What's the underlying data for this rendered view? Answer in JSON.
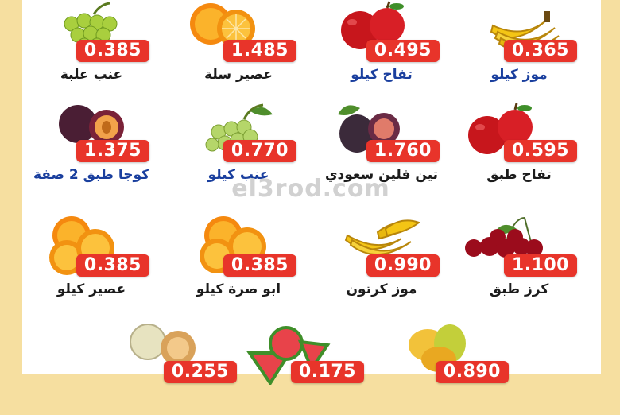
{
  "items": [
    {
      "id": "banana-kilo",
      "name": "موز كيلو",
      "price": "0.365",
      "fruit": "banana",
      "name_color": "blue"
    },
    {
      "id": "apple-kilo",
      "name": "تفاح كيلو",
      "price": "0.495",
      "fruit": "apple",
      "name_color": "blue"
    },
    {
      "id": "orange-juice-basket",
      "name": "عصير سلة",
      "price": "1.485",
      "fruit": "orange",
      "name_color": "dark"
    },
    {
      "id": "grapes-box",
      "name": "عنب علبة",
      "price": "0.385",
      "fruit": "grapes",
      "name_color": "dark"
    },
    {
      "id": "apple-tray",
      "name": "تفاح طبق",
      "price": "0.595",
      "fruit": "apple",
      "name_color": "dark"
    },
    {
      "id": "fig-saudi",
      "name": "تين فلين سعودي",
      "price": "1.760",
      "fruit": "fig",
      "name_color": "dark"
    },
    {
      "id": "grapes-kilo",
      "name": "عنب كيلو",
      "price": "0.770",
      "fruit": "grapes",
      "name_color": "blue"
    },
    {
      "id": "plum-tray",
      "name": "كوجا طبق 2 صفة",
      "price": "1.375",
      "fruit": "plum",
      "name_color": "blue"
    },
    {
      "id": "cherry-tray",
      "name": "كرز طبق",
      "price": "1.100",
      "fruit": "cherry",
      "name_color": "dark"
    },
    {
      "id": "banana-carton",
      "name": "موز كرتون",
      "price": "0.990",
      "fruit": "banana",
      "name_color": "dark"
    },
    {
      "id": "orange-navel-kilo",
      "name": "ابو صرة كيلو",
      "price": "0.385",
      "fruit": "orange",
      "name_color": "dark"
    },
    {
      "id": "orange-juice-kilo",
      "name": "عصير كيلو",
      "price": "0.385",
      "fruit": "orange",
      "name_color": "dark"
    },
    {
      "id": "mango",
      "name": "",
      "price": "0.890",
      "fruit": "mango",
      "name_color": "dark"
    },
    {
      "id": "watermelon",
      "name": "",
      "price": "0.175",
      "fruit": "watermelon",
      "name_color": "dark"
    },
    {
      "id": "melon",
      "name": "",
      "price": "0.255",
      "fruit": "melon",
      "name_color": "dark"
    }
  ],
  "watermark": "el3rod.com"
}
